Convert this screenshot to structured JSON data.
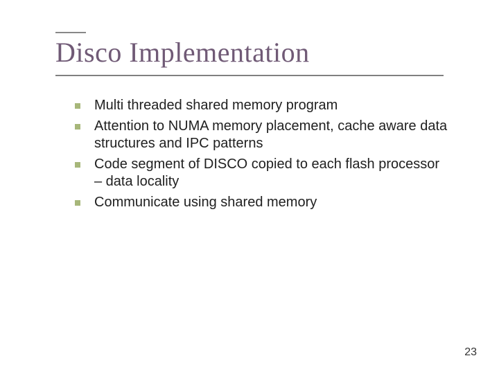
{
  "title": "Disco Implementation",
  "bullets": [
    "Multi threaded shared memory program",
    "Attention to NUMA memory placement, cache aware data structures and IPC patterns",
    "Code segment of DISCO copied to each flash processor – data locality",
    "Communicate using shared memory"
  ],
  "page_number": "23"
}
